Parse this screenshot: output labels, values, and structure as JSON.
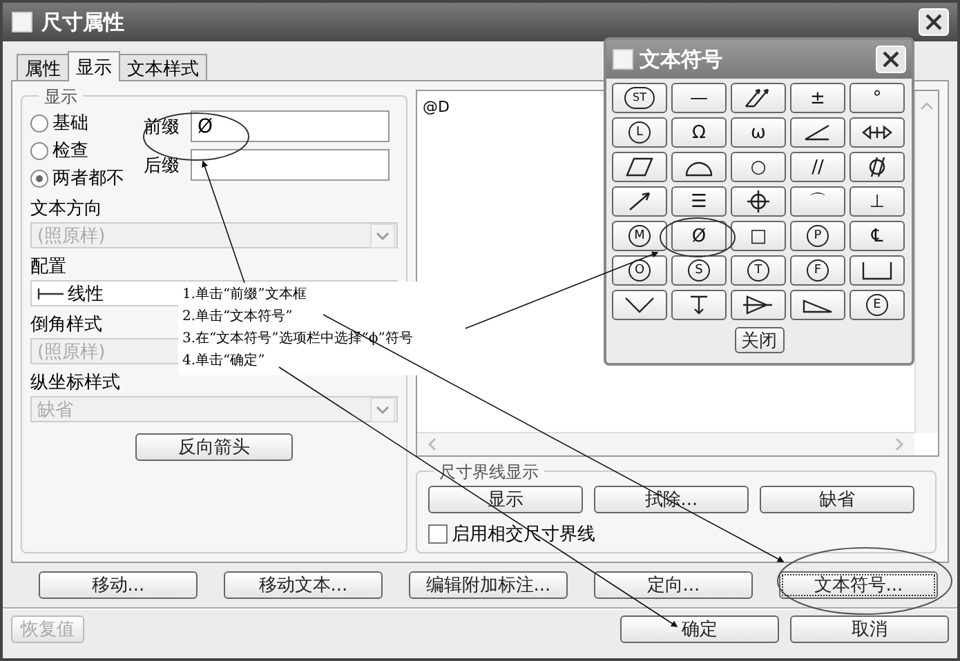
{
  "window": {
    "title": "尺寸属性"
  },
  "tabs": [
    {
      "label": "属性",
      "selected": false
    },
    {
      "label": "显示",
      "selected": true
    },
    {
      "label": "文本样式",
      "selected": false
    }
  ],
  "display_group": {
    "title": "显示",
    "radios": [
      {
        "label": "基础",
        "selected": false
      },
      {
        "label": "检查",
        "selected": false
      },
      {
        "label": "两者都不",
        "selected": true
      }
    ],
    "prefix": {
      "label": "前缀",
      "value": "Ø"
    },
    "suffix": {
      "label": "后缀"
    }
  },
  "fields": [
    {
      "label": "文本方向",
      "value": "(照原样)",
      "disabled": true,
      "kind": "plain"
    },
    {
      "label": "配置",
      "value": "线性",
      "disabled": false,
      "kind": "linear"
    },
    {
      "label": "倒角样式",
      "value": "(照原样)",
      "disabled": true,
      "kind": "plain"
    },
    {
      "label": "纵坐标样式",
      "value": "缺省",
      "disabled": true,
      "kind": "plain"
    }
  ],
  "reverse_arrows_button": "反向箭头",
  "text_area": {
    "value": "@D"
  },
  "witness_group": {
    "title": "尺寸界线显示",
    "buttons": [
      "显示",
      "拭除...",
      "缺省"
    ],
    "checkbox": {
      "label": "启用相交尺寸界线",
      "checked": false
    }
  },
  "action_buttons": [
    {
      "label": "移动...",
      "focused": false
    },
    {
      "label": "移动文本...",
      "focused": false
    },
    {
      "label": "编辑附加标注...",
      "focused": false
    },
    {
      "label": "定向...",
      "focused": false
    },
    {
      "label": "文本符号...",
      "focused": true
    }
  ],
  "restore_button": {
    "label": "恢复值",
    "disabled": true
  },
  "dialog_buttons": [
    "确定",
    "取消"
  ],
  "symbol_palette": {
    "title": "文本符号",
    "close_button": "关闭",
    "symbols": [
      {
        "kind": "circled",
        "text": "ST"
      },
      {
        "kind": "text",
        "text": "—"
      },
      {
        "kind": "arrows"
      },
      {
        "kind": "text",
        "text": "±"
      },
      {
        "kind": "text",
        "text": "°"
      },
      {
        "kind": "circled",
        "text": "L"
      },
      {
        "kind": "text",
        "text": "Ω"
      },
      {
        "kind": "text",
        "text": "ω"
      },
      {
        "kind": "angle"
      },
      {
        "kind": "bidirectional"
      },
      {
        "kind": "parallelogram"
      },
      {
        "kind": "semicircle"
      },
      {
        "kind": "text",
        "text": "○"
      },
      {
        "kind": "text",
        "text": "//"
      },
      {
        "kind": "cylindricity"
      },
      {
        "kind": "arrow"
      },
      {
        "kind": "text",
        "text": "☰"
      },
      {
        "kind": "position"
      },
      {
        "kind": "text",
        "text": "⌒"
      },
      {
        "kind": "text",
        "text": "⊥"
      },
      {
        "kind": "circled",
        "text": "M"
      },
      {
        "kind": "text",
        "text": "Ø"
      },
      {
        "kind": "text",
        "text": "□"
      },
      {
        "kind": "circled",
        "text": "P"
      },
      {
        "kind": "text",
        "text": "℄"
      },
      {
        "kind": "circled",
        "text": "O"
      },
      {
        "kind": "circled",
        "text": "S"
      },
      {
        "kind": "circled",
        "text": "T"
      },
      {
        "kind": "circled",
        "text": "F"
      },
      {
        "kind": "counterbore"
      },
      {
        "kind": "countersink"
      },
      {
        "kind": "depth"
      },
      {
        "kind": "taper"
      },
      {
        "kind": "slope"
      },
      {
        "kind": "circled",
        "text": "E"
      }
    ]
  },
  "annotations": [
    "1.单击“前缀”文本框",
    "2.单击“文本符号”",
    "3.在“文本符号”选项栏中选择“ϕ”符号",
    "4.单击“确定”"
  ]
}
